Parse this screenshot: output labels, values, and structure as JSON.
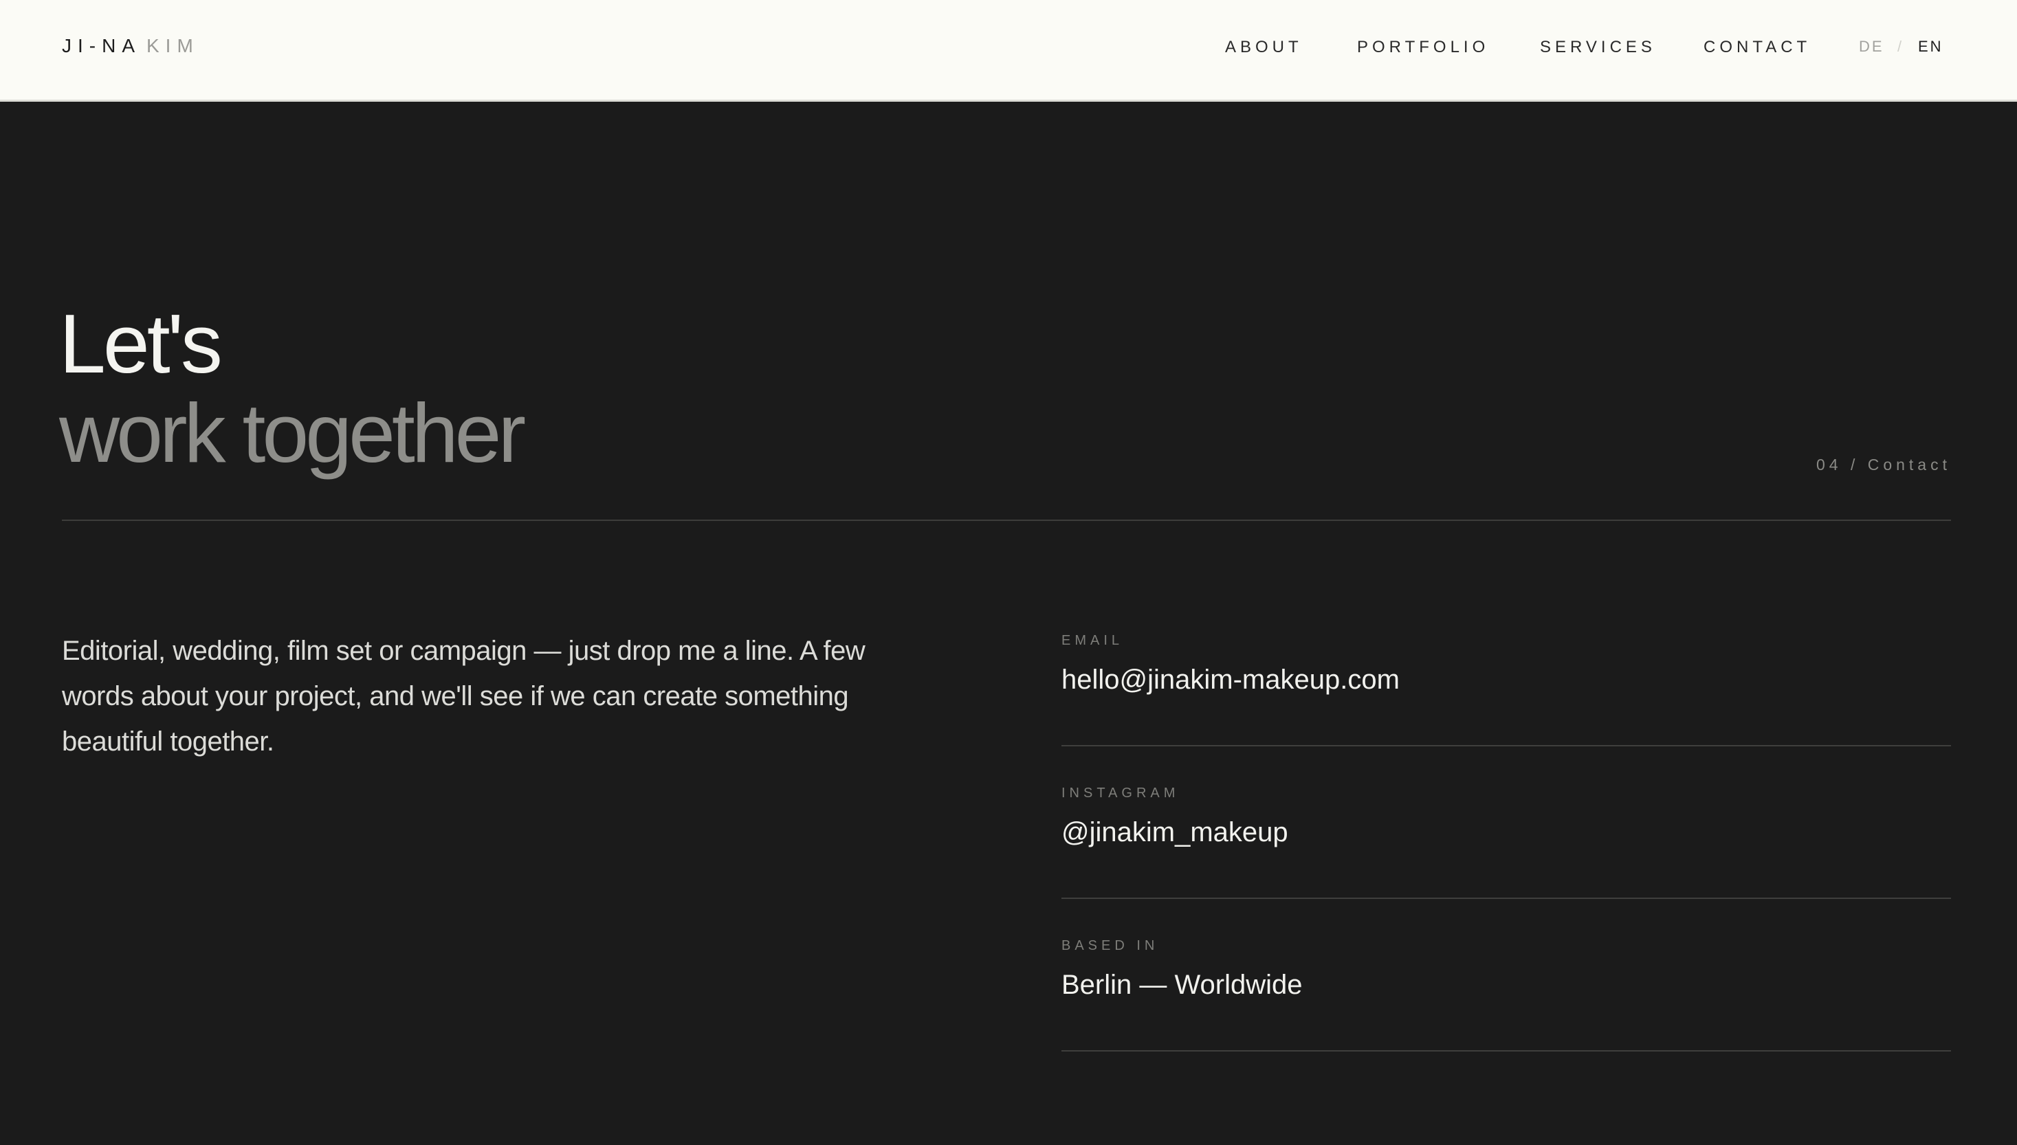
{
  "header": {
    "brand_first": "JI-NA",
    "brand_last": "KIM",
    "nav": {
      "about": "ABOUT",
      "portfolio": "PORTFOLIO",
      "services": "SERVICES",
      "contact": "CONTACT"
    },
    "lang": {
      "de": "DE",
      "separator": "/",
      "en": "EN",
      "active": "EN"
    }
  },
  "hero": {
    "line1": "Let's",
    "line2": "work together",
    "section_label": "04 / Contact"
  },
  "intro": "Editorial, wedding, film set or campaign — just drop me a line. A few words about your project, and we'll see if we can create something beautiful together.",
  "contacts": {
    "email": {
      "label": "EMAIL",
      "value": "hello@jinakim-makeup.com"
    },
    "instagram": {
      "label": "INSTAGRAM",
      "value": "@jinakim_makeup"
    },
    "location": {
      "label": "BASED IN",
      "value": "Berlin — Worldwide"
    }
  },
  "colors": {
    "header_bg": "#fbfbf6",
    "page_bg": "#1b1b1b",
    "text_light": "#f4f4f0",
    "text_muted": "#8e8e8a",
    "divider": "#3d3d3b"
  }
}
